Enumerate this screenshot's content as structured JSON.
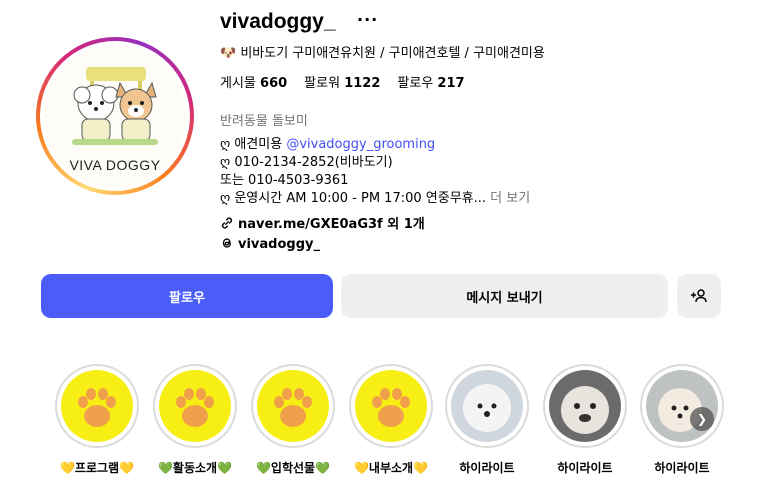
{
  "profile": {
    "username": "vivadoggy_",
    "more": "···",
    "category": "🐶 비바도기 구미애견유치원 / 구미애견호텔 / 구미애견미용",
    "avatar_text": "VIVA DOGGY",
    "stats": {
      "posts_label": "게시물",
      "posts": "660",
      "followers_label": "팔로워",
      "followers": "1122",
      "following_label": "팔로우",
      "following": "217"
    },
    "bio": {
      "line1": "반려동물 돌보미",
      "line2_prefix": "ღ 애견미용 ",
      "line2_link": "@vivadoggy_grooming",
      "line3": "ღ 010-2134-2852(비바도기)",
      "line4": "또는 010-4503-9361",
      "line5": "ღ 운영시간 AM 10:00 - PM 17:00 연중무휴...",
      "more": " 더 보기"
    },
    "link": "naver.me/GXE0aG3f 외 1개",
    "threads": "vivadoggy_"
  },
  "actions": {
    "follow": "팔로우",
    "message": "메시지 보내기",
    "add_user_icon": "+person-icon"
  },
  "highlights": [
    {
      "label_pre": "💛",
      "label": "프로그램",
      "label_post": "💛",
      "type": "paw"
    },
    {
      "label_pre": "💚",
      "label": "활동소개",
      "label_post": "💚",
      "type": "paw"
    },
    {
      "label_pre": "💚",
      "label": "입학선물",
      "label_post": "💚",
      "type": "paw"
    },
    {
      "label_pre": "💛",
      "label": "내부소개",
      "label_post": "💛",
      "type": "paw"
    },
    {
      "label_pre": "",
      "label": "하이라이트",
      "label_post": "",
      "type": "dog-white"
    },
    {
      "label_pre": "",
      "label": "하이라이트",
      "label_post": "",
      "type": "dog-gray"
    },
    {
      "label_pre": "",
      "label": "하이라이트",
      "label_post": "",
      "type": "dog-cream"
    }
  ],
  "colors": {
    "follow_button": "#4a5df9",
    "link": "#4150f7",
    "paw_bg": "#f7ee14",
    "paw": "#f0a04b"
  }
}
